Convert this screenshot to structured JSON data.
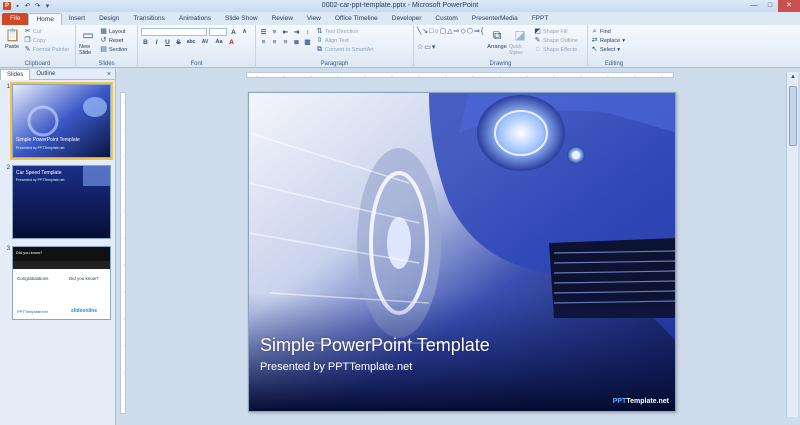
{
  "window": {
    "title": "0002-car-ppt-template.pptx - Microsoft PowerPoint"
  },
  "qat": {
    "icons": [
      "app-icon",
      "save-icon",
      "undo-icon",
      "redo-icon",
      "repeat-icon"
    ]
  },
  "tabs": [
    "File",
    "Home",
    "Insert",
    "Design",
    "Transitions",
    "Animations",
    "Slide Show",
    "Review",
    "View",
    "Office Timeline",
    "Developer",
    "Custom",
    "PresenterMedia",
    "FPPT"
  ],
  "ribbon": {
    "clipboard": {
      "label": "Clipboard",
      "paste": "Paste",
      "cut": "Cut",
      "copy": "Copy",
      "format_painter": "Format Painter"
    },
    "slides": {
      "label": "Slides",
      "new_slide": "New Slide",
      "layout": "Layout",
      "reset": "Reset",
      "section": "Section"
    },
    "font": {
      "label": "Font",
      "bold": "B",
      "italic": "I",
      "underline": "U",
      "strike": "S",
      "shadow": "abc",
      "spacing": "AV",
      "case": "Aa",
      "color": "A"
    },
    "paragraph": {
      "label": "Paragraph",
      "text_direction": "Text Direction",
      "align_text": "Align Text",
      "convert_smartart": "Convert to SmartArt"
    },
    "drawing": {
      "label": "Drawing",
      "arrange": "Arrange",
      "quick_styles": "Quick Styles",
      "shape_fill": "Shape Fill",
      "shape_outline": "Shape Outline",
      "shape_effects": "Shape Effects"
    },
    "editing": {
      "label": "Editing",
      "find": "Find",
      "replace": "Replace",
      "select": "Select"
    }
  },
  "panel": {
    "tab_slides": "Slides",
    "tab_outline": "Outline",
    "close": "×",
    "thumbs": [
      {
        "num": "1",
        "title": "Simple PowerPoint Template",
        "sub": "Presented by PPTTemplate.net"
      },
      {
        "num": "2",
        "title": "Car Speed Template",
        "sub": "Presented by PPTTemplate.net"
      },
      {
        "num": "3",
        "title": "Did you know?",
        "c1": "Congratulations",
        "c2": "Did you know?",
        "b1": "PPTTemplate.net",
        "b2": "slideonline"
      }
    ]
  },
  "slide": {
    "title": "Simple PowerPoint Template",
    "subtitle": "Presented by PPTTemplate.net",
    "brand_a": "PPT",
    "brand_b": "Template.net"
  },
  "colors": {
    "accent": "#d24726",
    "ribbon": "#dde8f4",
    "slide_dark": "#0a1a52",
    "car_blue": "#2e47b8"
  }
}
